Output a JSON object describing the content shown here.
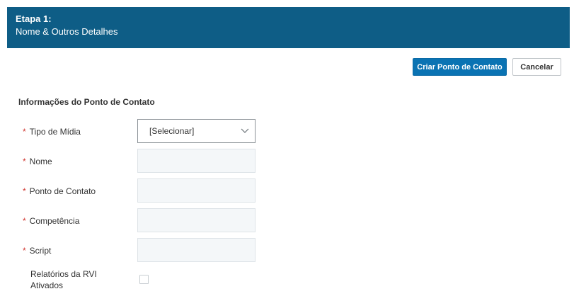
{
  "header": {
    "step": "Etapa 1:",
    "subtitle": "Nome & Outros Detalhes"
  },
  "actions": {
    "create_label": "Criar Ponto de Contato",
    "cancel_label": "Cancelar"
  },
  "form": {
    "section_title": "Informações do Ponto de Contato",
    "required_marker": "*",
    "media_type": {
      "label": "Tipo de Mídia",
      "value": "[Selecionar]",
      "icon": "chevron-down-icon"
    },
    "name": {
      "label": "Nome",
      "value": ""
    },
    "contact_point": {
      "label": "Ponto de Contato",
      "value": ""
    },
    "skill": {
      "label": "Competência",
      "value": ""
    },
    "script": {
      "label": "Script",
      "value": ""
    },
    "ivr_reports": {
      "label_line1": "Relatórios da RVI",
      "label_line2": "Ativados",
      "checked": false
    }
  }
}
